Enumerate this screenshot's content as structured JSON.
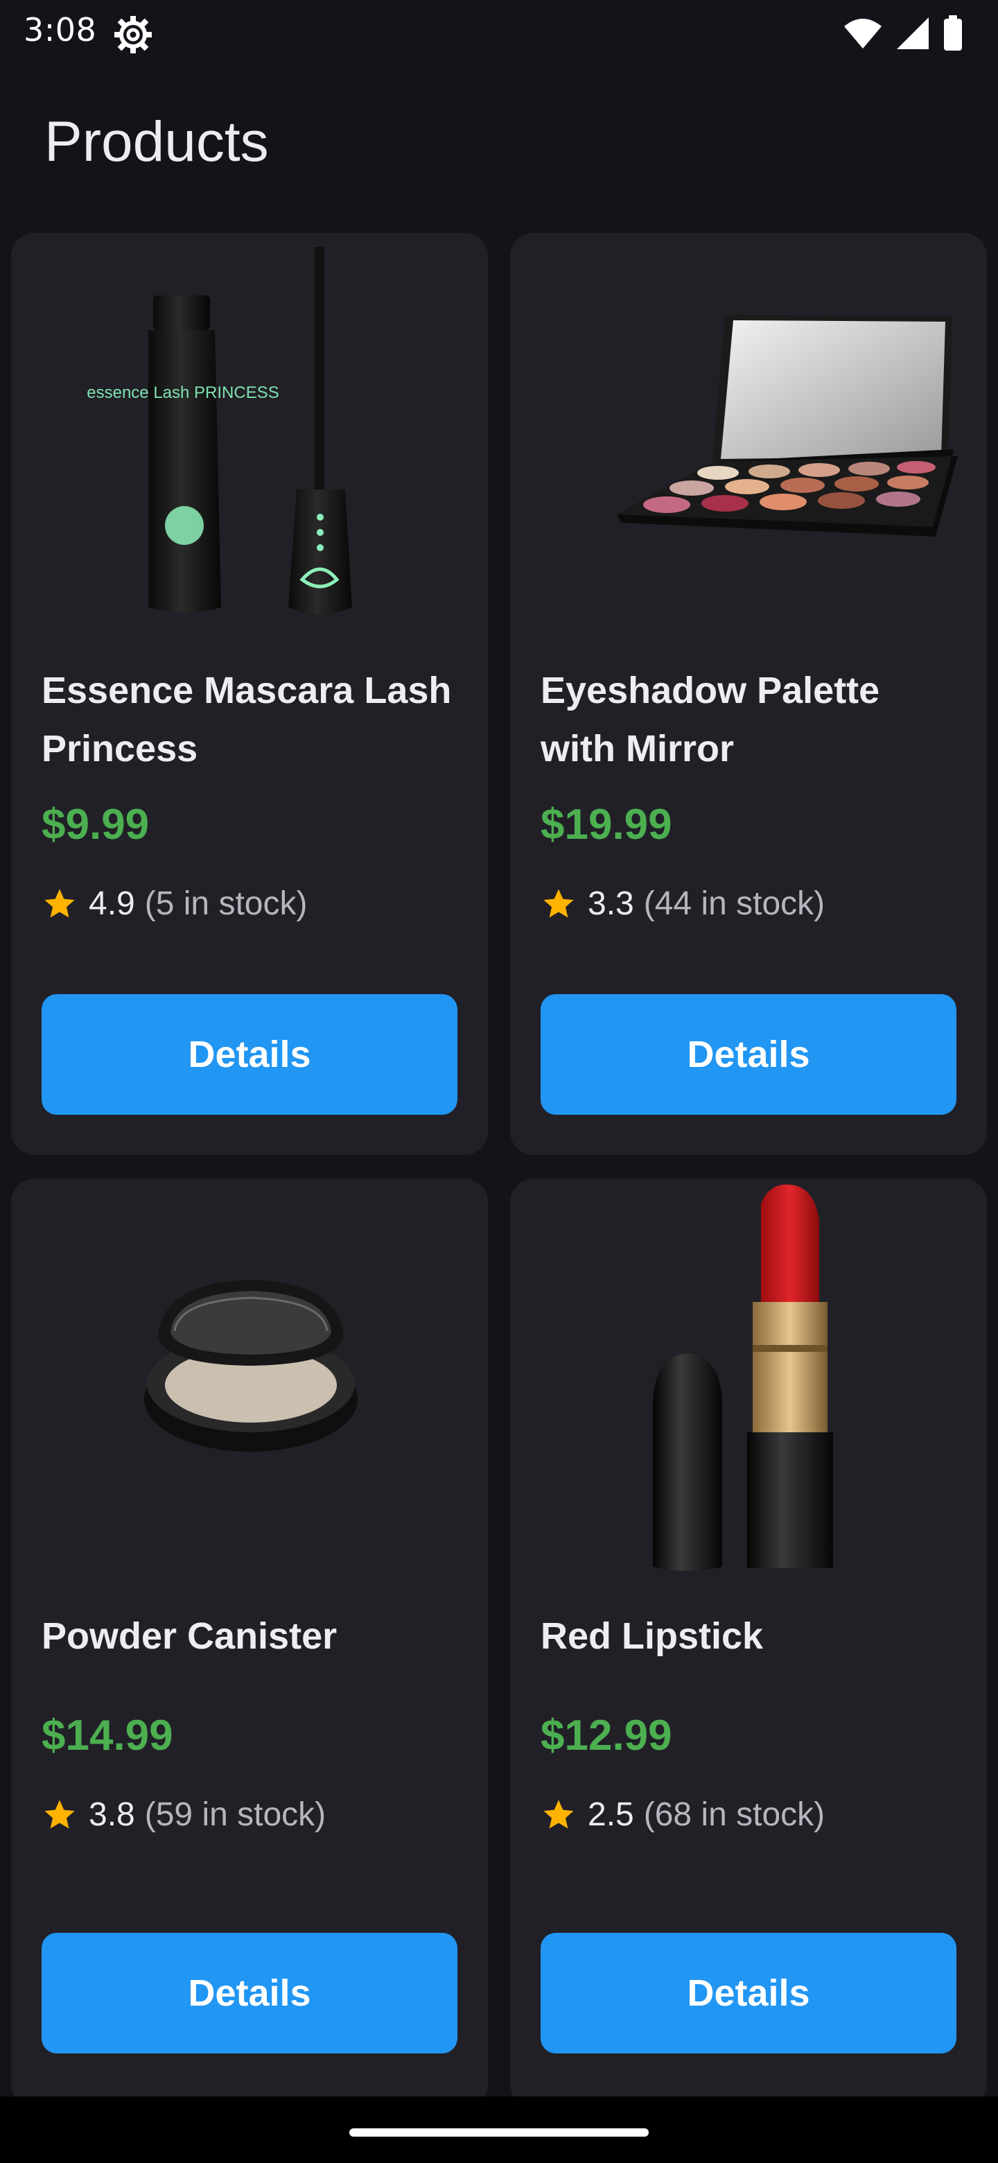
{
  "status_bar": {
    "time": "3:08",
    "icons": [
      "settings-icon",
      "wifi-icon",
      "signal-icon",
      "battery-icon"
    ]
  },
  "app_bar": {
    "title": "Products"
  },
  "colors": {
    "background": "#14131a",
    "card": "#212027",
    "price": "#4caf50",
    "button": "#2196f3",
    "star": "#ffb300"
  },
  "products": [
    {
      "name": "Essence Mascara Lash Princess",
      "price": "$9.99",
      "rating": "4.9",
      "stock": "(5 in stock)",
      "button": "Details",
      "image_icon": "mascara-icon",
      "image_text": "essence Lash PRINCESS"
    },
    {
      "name": "Eyeshadow Palette with Mirror",
      "price": "$19.99",
      "rating": "3.3",
      "stock": "(44 in stock)",
      "button": "Details",
      "image_icon": "eyeshadow-palette-icon"
    },
    {
      "name": "Powder Canister",
      "price": "$14.99",
      "rating": "3.8",
      "stock": "(59 in stock)",
      "button": "Details",
      "image_icon": "powder-compact-icon"
    },
    {
      "name": "Red Lipstick",
      "price": "$12.99",
      "rating": "2.5",
      "stock": "(68 in stock)",
      "button": "Details",
      "image_icon": "lipstick-icon"
    }
  ]
}
